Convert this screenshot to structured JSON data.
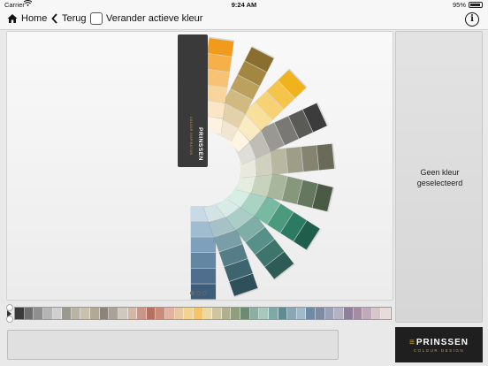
{
  "status_bar": {
    "carrier": "Carrier",
    "time": "9:24 AM",
    "battery": "95%"
  },
  "nav": {
    "home_label": "Home",
    "back_label": "Terug",
    "toggle_label": "Verander actieve kleur",
    "info_label": "i"
  },
  "fan": {
    "brand_name": "PRINSSEN",
    "brand_tagline": "COLOUR INSPIRATION",
    "blades": [
      {
        "name": "blue",
        "colors": [
          "#3e5d7a",
          "#4f6e8d",
          "#6386a3",
          "#7fa0bb",
          "#a0bcd1",
          "#c8dae6"
        ]
      },
      {
        "name": "petrol",
        "colors": [
          "#2f4f5a",
          "#3e6470",
          "#547d88",
          "#7a9ea7",
          "#a6c1c7",
          "#d3e3e5"
        ]
      },
      {
        "name": "teal-green",
        "colors": [
          "#2e5b55",
          "#3d746b",
          "#579088",
          "#7eaea6",
          "#abcdc7",
          "#d8ebe7"
        ]
      },
      {
        "name": "green",
        "colors": [
          "#1f5e4a",
          "#2c7a61",
          "#4a9a7e",
          "#78b9a1",
          "#a9d4c3",
          "#d7eee4"
        ]
      },
      {
        "name": "sage",
        "colors": [
          "#4a5a45",
          "#66775f",
          "#86977c",
          "#a7b69c",
          "#c8d3bd",
          "#e6ecdf"
        ]
      },
      {
        "name": "olive-grey",
        "colors": [
          "#6a6a58",
          "#848470",
          "#9e9e88",
          "#b8b8a2",
          "#d1d1bf",
          "#e9e9dd"
        ]
      },
      {
        "name": "grey",
        "colors": [
          "#3c3c3c",
          "#5a5a57",
          "#797874",
          "#9a9893",
          "#bfbdb6",
          "#e0ded8"
        ]
      },
      {
        "name": "yellow",
        "colors": [
          "#f0b31c",
          "#f5c54b",
          "#f7d274",
          "#f9df9c",
          "#fbebc2",
          "#fdf5e1"
        ]
      },
      {
        "name": "ochre",
        "colors": [
          "#8a6e2e",
          "#a38640",
          "#bca05e",
          "#d1b982",
          "#e3d1aa",
          "#f1e6d2"
        ]
      },
      {
        "name": "orange",
        "colors": [
          "#f29a1c",
          "#f5b04a",
          "#f7c274",
          "#f9d59e",
          "#fbe5c4",
          "#fdf2e2"
        ]
      }
    ]
  },
  "page_indicator": {
    "pages": 3,
    "active": 0
  },
  "selection": {
    "empty_text": "Geen kleur\ngeselecteerd"
  },
  "color_strip": {
    "swatches": [
      "#3a3a3a",
      "#6e6e6e",
      "#8f8f8f",
      "#b5b5b5",
      "#d0d0d0",
      "#9a9a90",
      "#b9b3a4",
      "#c9c0ad",
      "#b2a896",
      "#8c8478",
      "#a8a29a",
      "#cfc8bf",
      "#d6b7a5",
      "#c89688",
      "#b56f63",
      "#c98b7a",
      "#e0b2a0",
      "#e6c9a2",
      "#f1d48f",
      "#f3c46a",
      "#e9d9a8",
      "#cfc5a0",
      "#b0b08c",
      "#8f9f7d",
      "#6d8a74",
      "#8ab0a1",
      "#a8c8bd",
      "#7ea9a6",
      "#5f8c93",
      "#8aa7b5",
      "#a3b9c8",
      "#6f8aa4",
      "#7d8aa1",
      "#9aa1b6",
      "#b4b1c4",
      "#8e7f9a",
      "#a48ca3",
      "#c0a9b8",
      "#d8c6cb",
      "#e8dcd8"
    ]
  },
  "brand": {
    "name": "PRINSSEN",
    "tagline": "COLOUR DESIGN"
  }
}
